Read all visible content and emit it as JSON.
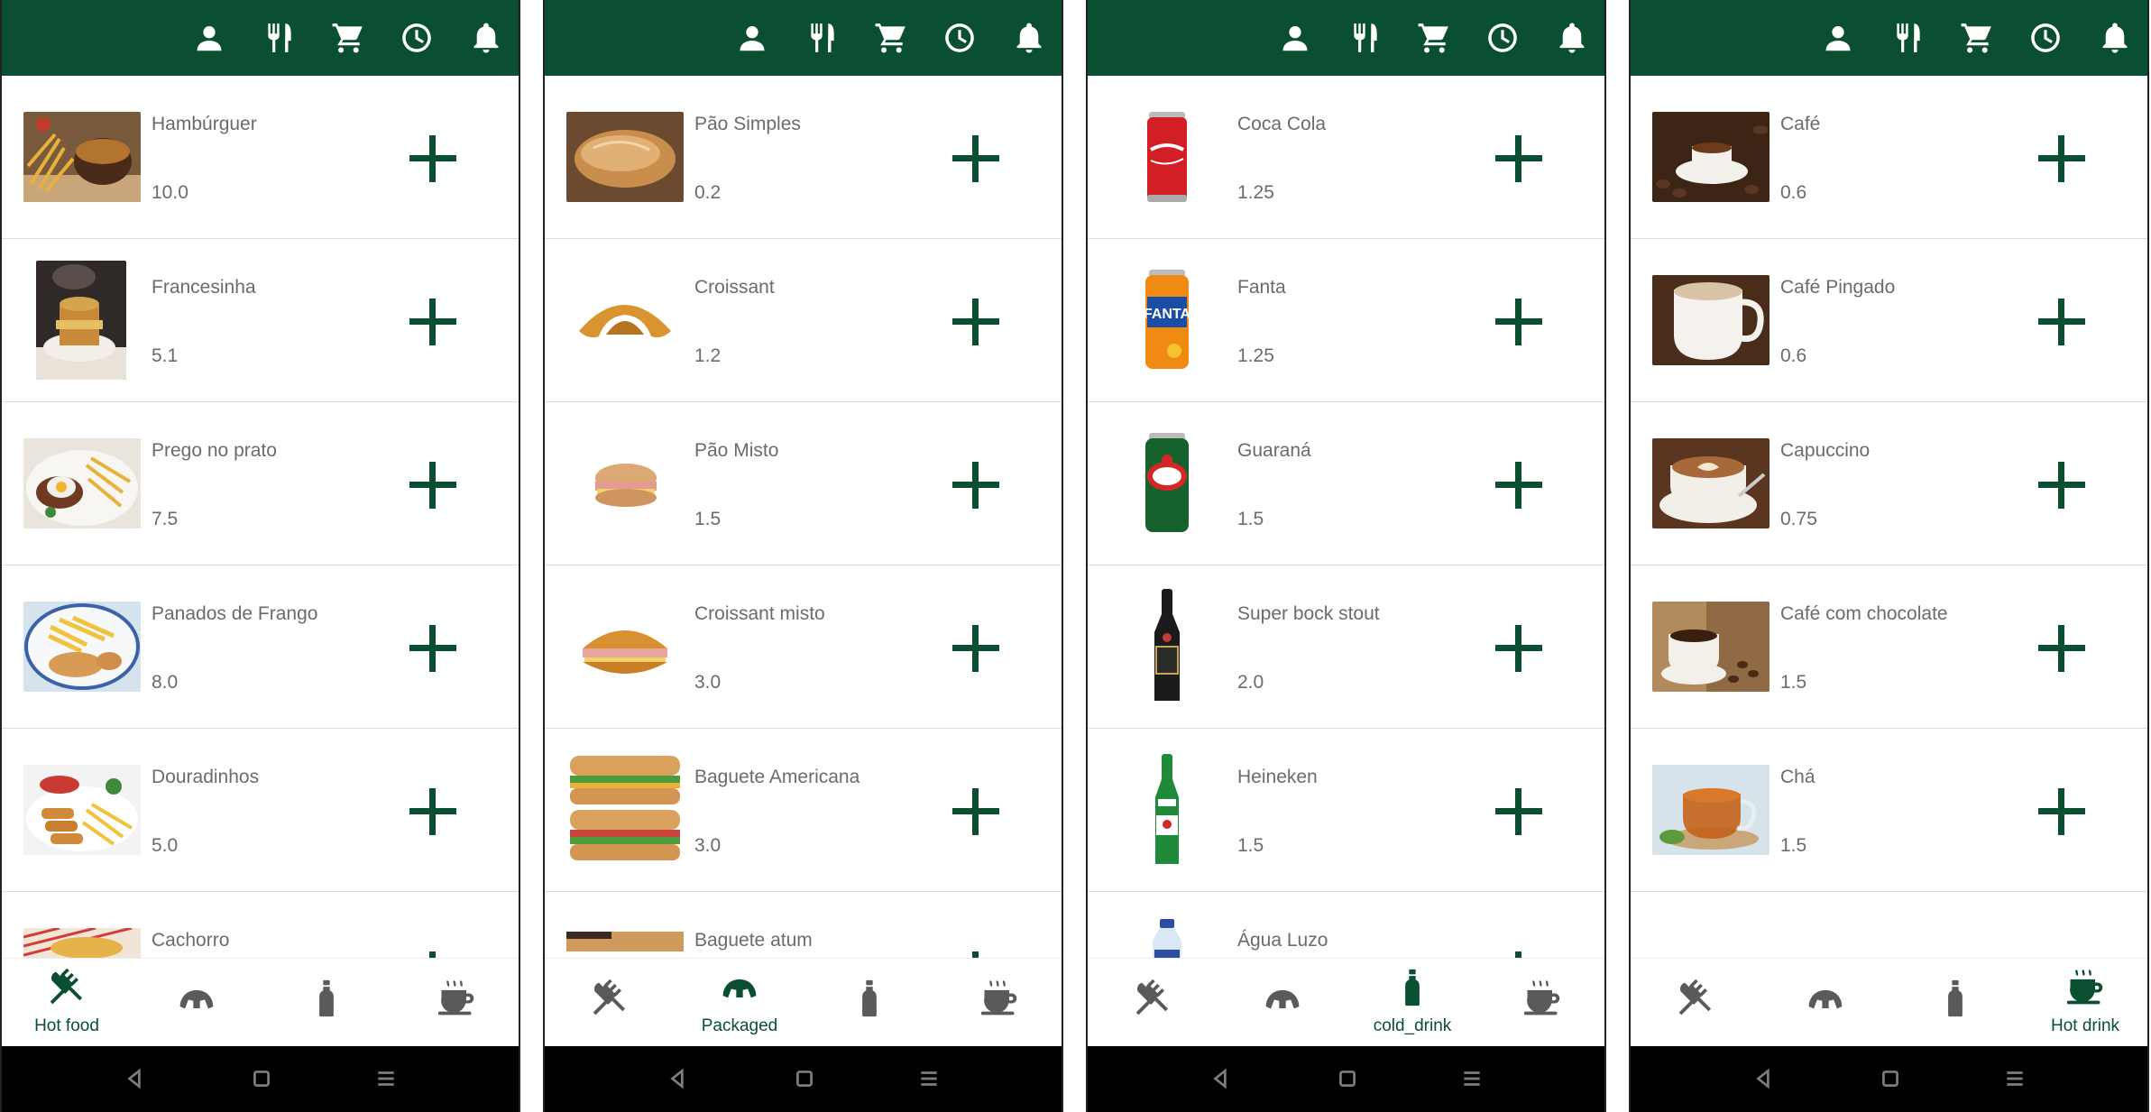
{
  "colors": {
    "primary": "#0b4f33",
    "text": "#6b6b6b",
    "nav_inactive": "#5a5a5a"
  },
  "top_bar_icons": [
    "person-icon",
    "restaurant-icon",
    "cart-icon",
    "clock-icon",
    "bell-icon"
  ],
  "nav_tabs": [
    {
      "key": "hot_food",
      "icon": "fork-knife-icon"
    },
    {
      "key": "packaged",
      "icon": "croissant-icon"
    },
    {
      "key": "cold_drink",
      "icon": "bottle-icon"
    },
    {
      "key": "hot_drink",
      "icon": "coffee-cup-icon"
    }
  ],
  "system_nav": [
    "back-icon",
    "home-icon",
    "menu-icon"
  ],
  "screens": [
    {
      "active_tab": 0,
      "active_tab_label": "Hot food",
      "items": [
        {
          "name": "Hambúrguer",
          "price": "10.0"
        },
        {
          "name": "Francesinha",
          "price": "5.1"
        },
        {
          "name": "Prego no prato",
          "price": "7.5"
        },
        {
          "name": "Panados de Frango",
          "price": "8.0"
        },
        {
          "name": "Douradinhos",
          "price": "5.0"
        },
        {
          "name": "Cachorro",
          "price": ""
        }
      ]
    },
    {
      "active_tab": 1,
      "active_tab_label": "Packaged",
      "items": [
        {
          "name": "Pão Simples",
          "price": "0.2"
        },
        {
          "name": "Croissant",
          "price": "1.2"
        },
        {
          "name": "Pão Misto",
          "price": "1.5"
        },
        {
          "name": "Croissant misto",
          "price": "3.0"
        },
        {
          "name": "Baguete Americana",
          "price": "3.0"
        },
        {
          "name": "Baguete atum",
          "price": ""
        }
      ]
    },
    {
      "active_tab": 2,
      "active_tab_label": "cold_drink",
      "items": [
        {
          "name": "Coca Cola",
          "price": "1.25"
        },
        {
          "name": "Fanta",
          "price": "1.25"
        },
        {
          "name": "Guaraná",
          "price": "1.5"
        },
        {
          "name": "Super bock stout",
          "price": "2.0"
        },
        {
          "name": "Heineken",
          "price": "1.5"
        },
        {
          "name": "Água Luzo",
          "price": ""
        }
      ]
    },
    {
      "active_tab": 3,
      "active_tab_label": "Hot drink",
      "items": [
        {
          "name": "Café",
          "price": "0.6"
        },
        {
          "name": "Café Pingado",
          "price": "0.6"
        },
        {
          "name": "Capuccino",
          "price": "0.75"
        },
        {
          "name": "Café com chocolate",
          "price": "1.5"
        },
        {
          "name": "Chá",
          "price": "1.5"
        }
      ]
    }
  ]
}
